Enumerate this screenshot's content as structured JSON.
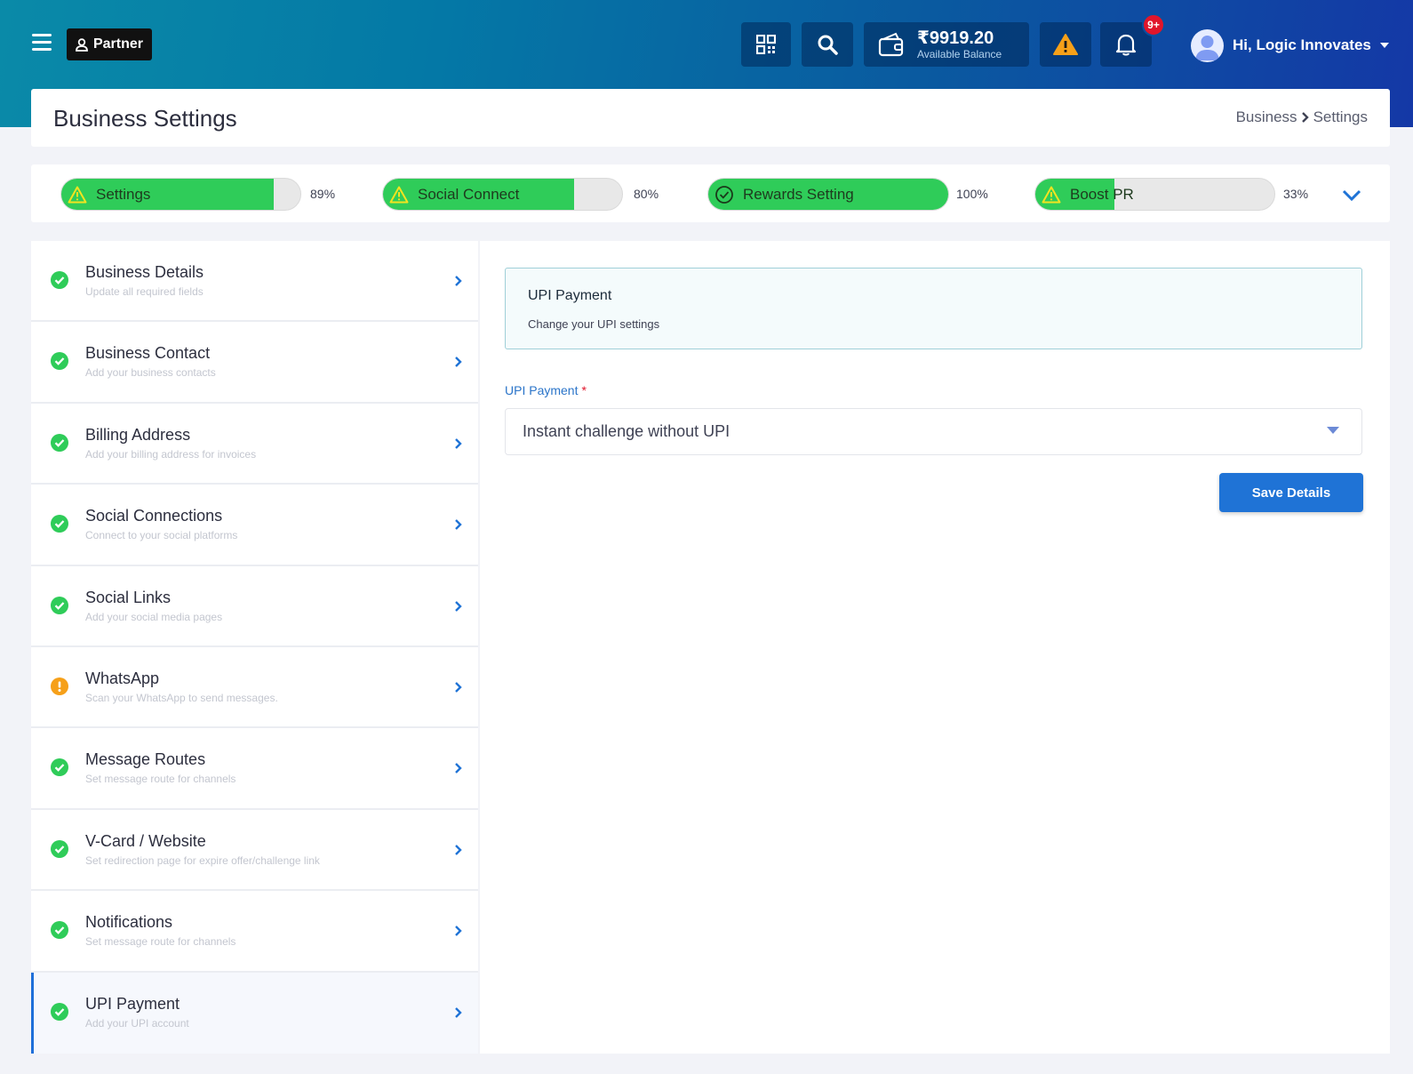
{
  "navbar": {
    "partner_label": "Partner",
    "wallet": {
      "amount": "₹9919.20",
      "label": "Available Balance"
    },
    "notification_badge": "9+",
    "user_greeting": "Hi, Logic Innovates"
  },
  "subheader": {
    "title": "Business Settings",
    "breadcrumb": [
      "Business",
      "Settings"
    ]
  },
  "progress": [
    {
      "label": "Settings",
      "percent": 89,
      "percent_text": "89%",
      "status": "warning"
    },
    {
      "label": "Social Connect",
      "percent": 80,
      "percent_text": "80%",
      "status": "warning"
    },
    {
      "label": "Rewards Setting",
      "percent": 100,
      "percent_text": "100%",
      "status": "complete"
    },
    {
      "label": "Boost PR",
      "percent": 33,
      "percent_text": "33%",
      "status": "warning"
    }
  ],
  "sidebar": {
    "items": [
      {
        "title": "Business Details",
        "desc": "Update all required fields",
        "status": "complete"
      },
      {
        "title": "Business Contact",
        "desc": "Add your business contacts",
        "status": "complete"
      },
      {
        "title": "Billing Address",
        "desc": "Add your billing address for invoices",
        "status": "complete"
      },
      {
        "title": "Social Connections",
        "desc": "Connect to your social platforms",
        "status": "complete"
      },
      {
        "title": "Social Links",
        "desc": "Add your social media pages",
        "status": "complete"
      },
      {
        "title": "WhatsApp",
        "desc": "Scan your WhatsApp to send messages.",
        "status": "warning"
      },
      {
        "title": "Message Routes",
        "desc": "Set message route for channels",
        "status": "complete"
      },
      {
        "title": "V-Card / Website",
        "desc": "Set redirection page for expire offer/challenge link",
        "status": "complete"
      },
      {
        "title": "Notifications",
        "desc": "Set message route for channels",
        "status": "complete"
      },
      {
        "title": "UPI Payment",
        "desc": "Add your UPI account",
        "status": "complete",
        "active": true
      }
    ]
  },
  "main": {
    "info_title": "UPI Payment",
    "info_subtitle": "Change your UPI settings",
    "field_label": "UPI Payment",
    "field_required_mark": "*",
    "select_value": "Instant challenge without UPI",
    "save_label": "Save Details"
  },
  "colors": {
    "accent": "#1f73d6",
    "success": "#2fcc59",
    "warning": "#f6a019",
    "badge": "#e0152b"
  }
}
